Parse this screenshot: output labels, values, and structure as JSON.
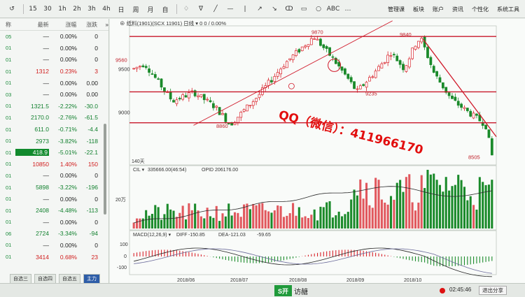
{
  "toolbar": {
    "icons": [
      "↺",
      "15",
      "30",
      "1h",
      "2h",
      "3h",
      "4h",
      "日",
      "周",
      "月",
      "自",
      "♢",
      "∇",
      "╱",
      "—",
      "|",
      "↗",
      "↘",
      "ↀ",
      "▭",
      "○",
      "ABC",
      "…"
    ],
    "menu": [
      "管理课",
      "板块",
      "账户",
      "资讯",
      "个性化",
      "系统工具"
    ]
  },
  "quote_header": {
    "code": "称",
    "latest": "最新",
    "pct": "涨幅",
    "chg": "涨跌",
    "more": "»"
  },
  "quotes": [
    {
      "code": "05",
      "latest": "—",
      "pct": "0.00%",
      "chg": "0",
      "dir": "flat"
    },
    {
      "code": "01",
      "latest": "—",
      "pct": "0.00%",
      "chg": "0",
      "dir": "flat"
    },
    {
      "code": "01",
      "latest": "—",
      "pct": "0.00%",
      "chg": "0",
      "dir": "flat"
    },
    {
      "code": "01",
      "latest": "1312",
      "pct": "0.23%",
      "chg": "3",
      "dir": "up"
    },
    {
      "code": "01",
      "latest": "—",
      "pct": "0.00%",
      "chg": "0.00",
      "dir": "flat"
    },
    {
      "code": "03",
      "latest": "—",
      "pct": "0.00%",
      "chg": "0.00",
      "dir": "flat"
    },
    {
      "code": "01",
      "latest": "1321.5",
      "pct": "-2.22%",
      "chg": "-30.0",
      "dir": "down"
    },
    {
      "code": "01",
      "latest": "2170.0",
      "pct": "-2.76%",
      "chg": "-61.5",
      "dir": "down"
    },
    {
      "code": "01",
      "latest": "611.0",
      "pct": "-0.71%",
      "chg": "-4.4",
      "dir": "down"
    },
    {
      "code": "01",
      "latest": "2973",
      "pct": "-3.82%",
      "chg": "-118",
      "dir": "down"
    },
    {
      "code": "01",
      "latest": "418.9",
      "pct": "-5.01%",
      "chg": "-22.1",
      "dir": "down",
      "selected": true
    },
    {
      "code": "01",
      "latest": "10850",
      "pct": "1.40%",
      "chg": "150",
      "dir": "up"
    },
    {
      "code": "01",
      "latest": "—",
      "pct": "0.00%",
      "chg": "0",
      "dir": "flat"
    },
    {
      "code": "01",
      "latest": "5898",
      "pct": "-3.22%",
      "chg": "-196",
      "dir": "down"
    },
    {
      "code": "01",
      "latest": "—",
      "pct": "0.00%",
      "chg": "0",
      "dir": "flat"
    },
    {
      "code": "01",
      "latest": "2408",
      "pct": "-4.48%",
      "chg": "-113",
      "dir": "down"
    },
    {
      "code": "01",
      "latest": "—",
      "pct": "0.00%",
      "chg": "0",
      "dir": "flat"
    },
    {
      "code": "06",
      "latest": "2724",
      "pct": "-3.34%",
      "chg": "-94",
      "dir": "down"
    },
    {
      "code": "01",
      "latest": "—",
      "pct": "0.00%",
      "chg": "0",
      "dir": "flat"
    },
    {
      "code": "01",
      "latest": "3414",
      "pct": "0.68%",
      "chg": "23",
      "dir": "up"
    }
  ],
  "sheet_tabs": [
    {
      "label": "自选三",
      "active": false
    },
    {
      "label": "自选四",
      "active": false
    },
    {
      "label": "自选五",
      "active": false
    },
    {
      "label": "主力",
      "active": true
    }
  ],
  "chart": {
    "header": "⊕  纸料(1901)(SCX 11901)  日线  ▾  0  0 / 0.00%",
    "period_label": "140天",
    "price_ticks": [
      "9500",
      "9000"
    ],
    "price_annotations": [
      "9560",
      "8860",
      "9870",
      "9235",
      "9840",
      "8505"
    ],
    "cil_header": {
      "label": "CIL ▾",
      "value": "335666.00(46:54)",
      "opid_label": "OPID",
      "opid_value": "206176.00"
    },
    "volume_tick": "20万",
    "macd_header": {
      "label": "MACD(12,26,9) ▾",
      "diff_label": "DIFF",
      "diff": "-150.85",
      "dea_label": "DEA",
      "dea": "-121.03",
      "macd": "-59.65"
    },
    "macd_ticks": [
      "100",
      "0",
      "-100"
    ],
    "date_ticks": [
      "2018/06",
      "2018/07",
      "2018/08",
      "2018/09",
      "2018/10"
    ],
    "colors": {
      "up": "#d8222a",
      "down": "#1a8a2a",
      "level": "#c8182a",
      "trend": "#d01a2a",
      "oi": "#2a2a2a",
      "diff": "#222",
      "dea": "#6a6a9a"
    }
  },
  "watermark": "QQ（微信）：411966170",
  "taskbar": {
    "logo": "S开",
    "logo_text": "访赯",
    "clock": "02:45:46",
    "exit": "退出分享"
  }
}
